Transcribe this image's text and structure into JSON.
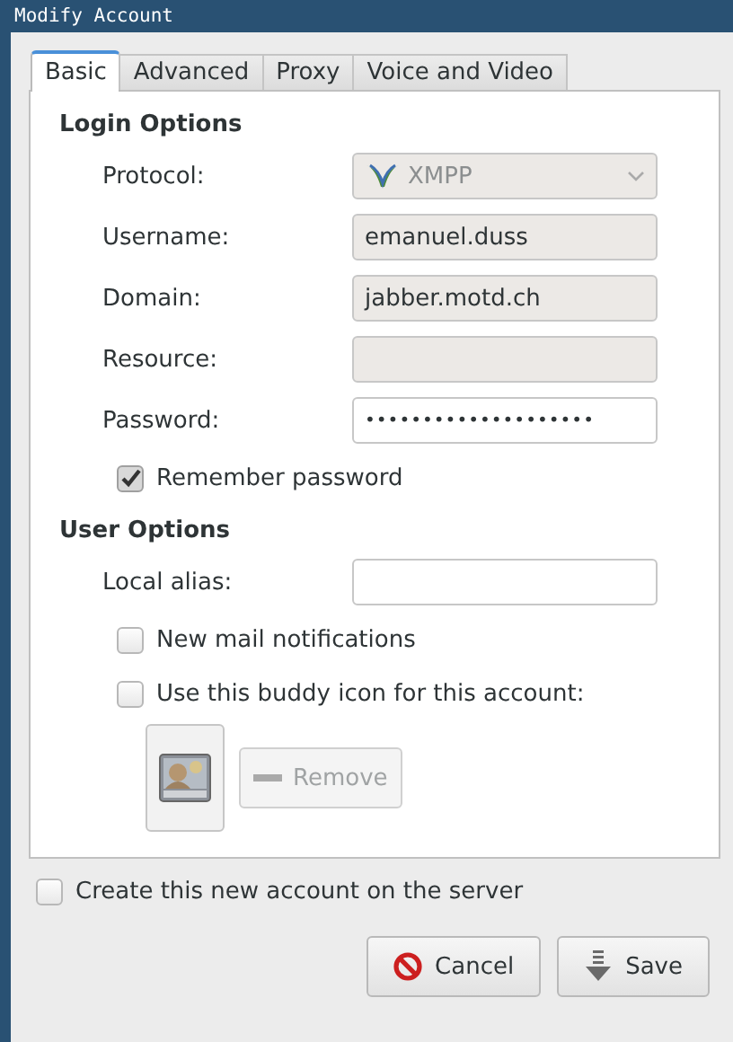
{
  "window": {
    "title": "Modify Account"
  },
  "tabs": [
    {
      "label": "Basic",
      "selected": true
    },
    {
      "label": "Advanced",
      "selected": false
    },
    {
      "label": "Proxy",
      "selected": false
    },
    {
      "label": "Voice and Video",
      "selected": false
    }
  ],
  "sections": [
    {
      "heading": "Login Options",
      "rows": [
        {
          "kind": "dropdown",
          "label": "Protocol:",
          "value": "XMPP",
          "disabled": true
        },
        {
          "kind": "entry",
          "label": "Username:",
          "value": "emanuel.duss",
          "disabled": true
        },
        {
          "kind": "entry",
          "label": "Domain:",
          "value": "jabber.motd.ch",
          "disabled": true
        },
        {
          "kind": "entry",
          "label": "Resource:",
          "disabled": true
        },
        {
          "kind": "entry",
          "label": "Password:",
          "value": "••••••••••••••••••••",
          "disabled": false
        },
        {
          "kind": "checkbox",
          "label": "Remember password",
          "checked": true
        }
      ]
    },
    {
      "heading": "User Options",
      "rows": [
        {
          "kind": "entry",
          "label": "Local alias:",
          "disabled": false
        },
        {
          "kind": "checkbox",
          "label": "New mail notifications",
          "checked": false
        },
        {
          "kind": "checkbox",
          "label": "Use this buddy icon for this account:",
          "checked": false
        },
        {
          "kind": "buddy_icon",
          "remove_button": {
            "label": "Remove",
            "disabled": true
          }
        }
      ]
    }
  ],
  "create_account": {
    "label": "Create this new account on the server",
    "checked": false
  },
  "buttons": [
    {
      "kind": "cancel",
      "label": "Cancel"
    },
    {
      "kind": "save",
      "label": "Save"
    }
  ]
}
